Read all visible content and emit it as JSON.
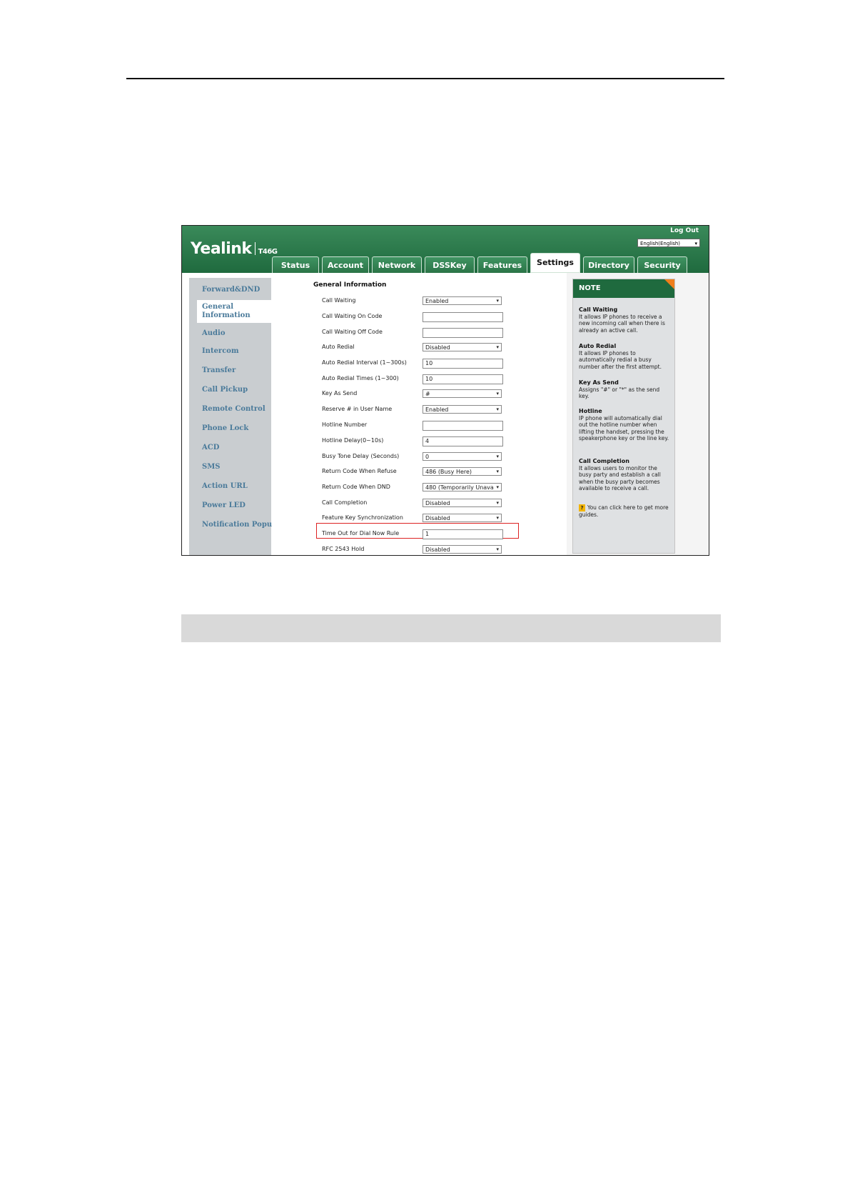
{
  "header": {
    "brand": "Yealink",
    "model": "T46G",
    "logout": "Log Out",
    "language": "English(English)"
  },
  "tabs": [
    {
      "label": "Status"
    },
    {
      "label": "Account"
    },
    {
      "label": "Network"
    },
    {
      "label": "DSSKey"
    },
    {
      "label": "Features"
    },
    {
      "label": "Settings"
    },
    {
      "label": "Directory"
    },
    {
      "label": "Security"
    }
  ],
  "sidebar": {
    "items": [
      {
        "label": "Forward&DND"
      },
      {
        "label": "General Information"
      },
      {
        "label": "Audio"
      },
      {
        "label": "Intercom"
      },
      {
        "label": "Transfer"
      },
      {
        "label": "Call Pickup"
      },
      {
        "label": "Remote Control"
      },
      {
        "label": "Phone Lock"
      },
      {
        "label": "ACD"
      },
      {
        "label": "SMS"
      },
      {
        "label": "Action URL"
      },
      {
        "label": "Power LED"
      },
      {
        "label": "Notification Popups"
      }
    ]
  },
  "form": {
    "section_title": "General Information",
    "rows": [
      {
        "label": "Call Waiting",
        "value": "Enabled"
      },
      {
        "label": "Call Waiting On Code",
        "value": ""
      },
      {
        "label": "Call Waiting Off Code",
        "value": ""
      },
      {
        "label": "Auto Redial",
        "value": "Disabled"
      },
      {
        "label": "Auto Redial Interval (1~300s)",
        "value": "10"
      },
      {
        "label": "Auto Redial Times (1~300)",
        "value": "10"
      },
      {
        "label": "Key As Send",
        "value": "#"
      },
      {
        "label": "Reserve # in User Name",
        "value": "Enabled"
      },
      {
        "label": "Hotline Number",
        "value": ""
      },
      {
        "label": "Hotline Delay(0~10s)",
        "value": "4"
      },
      {
        "label": "Busy Tone Delay (Seconds)",
        "value": "0"
      },
      {
        "label": "Return Code When Refuse",
        "value": "486 (Busy Here)"
      },
      {
        "label": "Return Code When DND",
        "value": "480 (Temporarily Unava"
      },
      {
        "label": "Call Completion",
        "value": "Disabled"
      },
      {
        "label": "Feature Key Synchronization",
        "value": "Disabled"
      },
      {
        "label": "Time Out for Dial Now Rule",
        "value": "1"
      },
      {
        "label": "RFC 2543 Hold",
        "value": "Disabled"
      }
    ]
  },
  "note": {
    "title": "NOTE",
    "sections": [
      {
        "title": "Call Waiting",
        "text": "It allows IP phones to receive a new incoming call when there is already an active call."
      },
      {
        "title": "Auto Redial",
        "text": "It allows IP phones to automatically redial a busy number after the first attempt."
      },
      {
        "title": "Key As Send",
        "text": "Assigns \"#\" or \"*\" as the send key."
      },
      {
        "title": "Hotline",
        "text": "IP phone will automatically dial out the hotline number when lifting the handset, pressing the speakerphone key or the line key."
      },
      {
        "title": "Call Completion",
        "text": "It allows users to monitor the busy party and establish a call when the busy party becomes available to receive a call."
      }
    ],
    "help": "You can click here to get more guides."
  }
}
